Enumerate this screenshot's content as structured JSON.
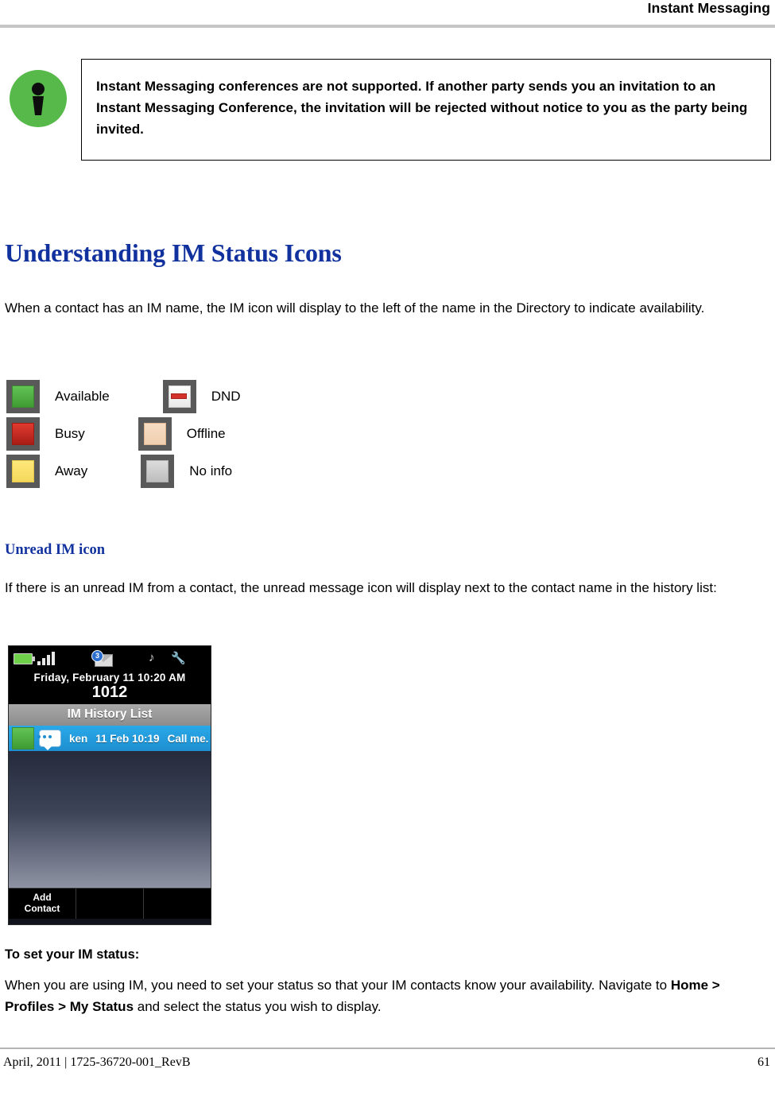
{
  "header": {
    "title": "Instant Messaging"
  },
  "note": {
    "icon": "note-info-icon",
    "text": "Instant Messaging conferences are not supported. If another party sends you an invitation to an Instant Messaging Conference, the invitation will be rejected without notice to you as the party being invited."
  },
  "section": {
    "heading": "Understanding IM Status Icons",
    "intro": "When a contact has an IM name, the IM icon will display to the left of the name in the Directory to indicate availability."
  },
  "status_icons": {
    "rows": [
      {
        "left_label": "Available",
        "left_icon": "status-available-icon",
        "right_label": "DND",
        "right_icon": "status-dnd-icon"
      },
      {
        "left_label": "Busy",
        "left_icon": "status-busy-icon",
        "right_label": "Offline",
        "right_icon": "status-offline-icon"
      },
      {
        "left_label": "Away",
        "left_icon": "status-away-icon",
        "right_label": "No info",
        "right_icon": "status-noinfo-icon"
      }
    ]
  },
  "unread": {
    "heading": "Unread IM icon",
    "text": "If there is an unread IM from a contact, the unread message icon will display next to the contact name in the history list:"
  },
  "phone": {
    "statusbar": {
      "battery_icon": "battery-icon",
      "signal_icon": "signal-bars-icon",
      "message_icon": "envelope-icon",
      "message_count": "3",
      "note_icon": "music-note-icon",
      "wrench_icon": "wrench-icon"
    },
    "date_line": "Friday, February 11 10:20 AM",
    "extension": "1012",
    "list_title": "IM History List",
    "row": {
      "presence_icon": "status-available-icon",
      "unread_icon": "unread-message-icon",
      "name": "ken",
      "timestamp": "11 Feb 10:19",
      "message": "Call me."
    },
    "softkeys": [
      "Add\nContact",
      "",
      ""
    ]
  },
  "set_status": {
    "heading": "To set your IM status:",
    "text_before": "When you are using IM, you need to set your status so that your IM contacts know your availability. Navigate to ",
    "path": "Home > Profiles > My Status",
    "text_after": " and select the status you wish to display."
  },
  "footer": {
    "left": "April, 2011  |  1725-36720-001_RevB",
    "page": "61"
  }
}
